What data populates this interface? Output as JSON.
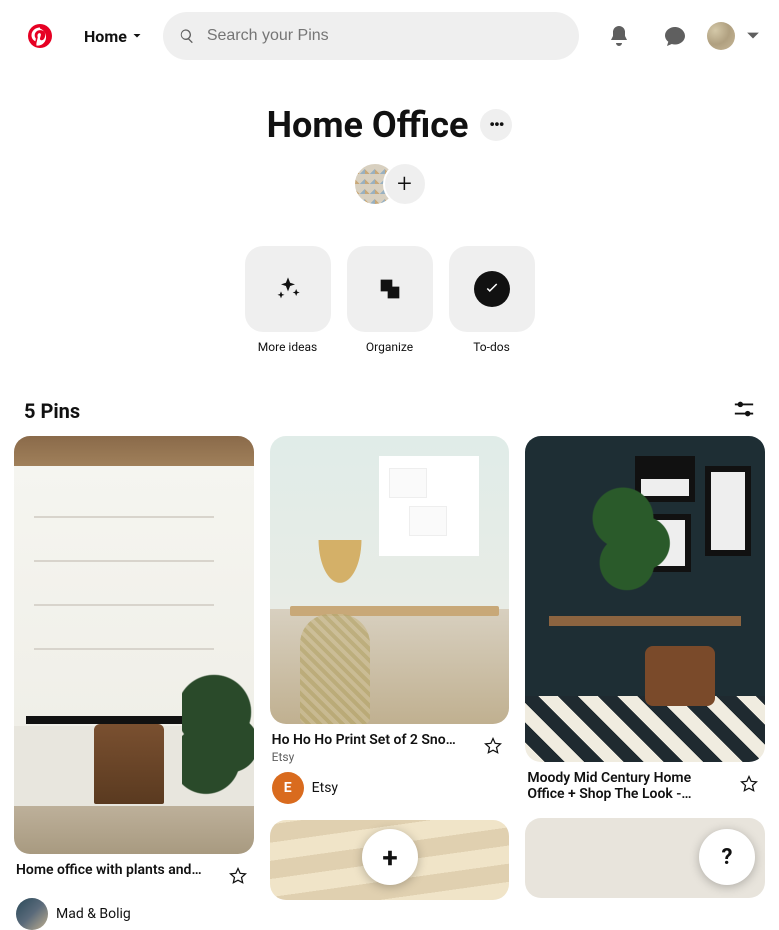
{
  "header": {
    "nav_home": "Home",
    "search_placeholder": "Search your Pins"
  },
  "board": {
    "title": "Home Office",
    "actions": {
      "more_ideas": "More ideas",
      "organize": "Organize",
      "todos": "To-dos"
    },
    "pins_label": "5 Pins"
  },
  "pins": [
    {
      "title": "Home office with plants and…",
      "attribution": "Mad & Bolig"
    },
    {
      "title": "Ho Ho Ho Print Set of 2 Sno…",
      "subtitle": "Etsy",
      "attribution": "Etsy",
      "avatar_letter": "E",
      "avatar_bg": "#d96b1e"
    },
    {
      "title": "Moody Mid Century Home Office + Shop The Look -…"
    }
  ],
  "fab": {
    "add": "+",
    "help": "?"
  }
}
